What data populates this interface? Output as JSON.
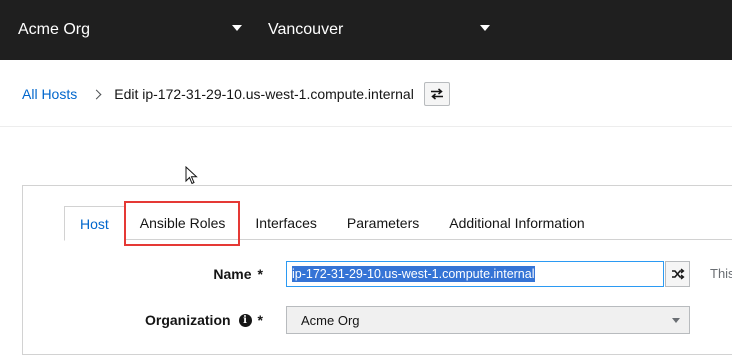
{
  "topbar": {
    "organization": "Acme Org",
    "location": "Vancouver"
  },
  "breadcrumb": {
    "parent": "All Hosts",
    "current": "Edit ip-172-31-29-10.us-west-1.compute.internal"
  },
  "tabs": [
    {
      "label": "Host",
      "active": true
    },
    {
      "label": "Ansible Roles",
      "highlighted": true
    },
    {
      "label": "Interfaces"
    },
    {
      "label": "Parameters"
    },
    {
      "label": "Additional Information"
    }
  ],
  "form": {
    "name_label": "Name",
    "name_required": "*",
    "name_value": "ip-172-31-29-10.us-west-1.compute.internal",
    "name_help": "This",
    "org_label": "Organization",
    "org_required": "*",
    "org_info_icon": "info-icon",
    "org_value": "Acme Org"
  },
  "colors": {
    "topbar": "#1f1f1f",
    "link": "#0066cc",
    "highlight_box": "#e53935",
    "selection": "#3574d6"
  }
}
